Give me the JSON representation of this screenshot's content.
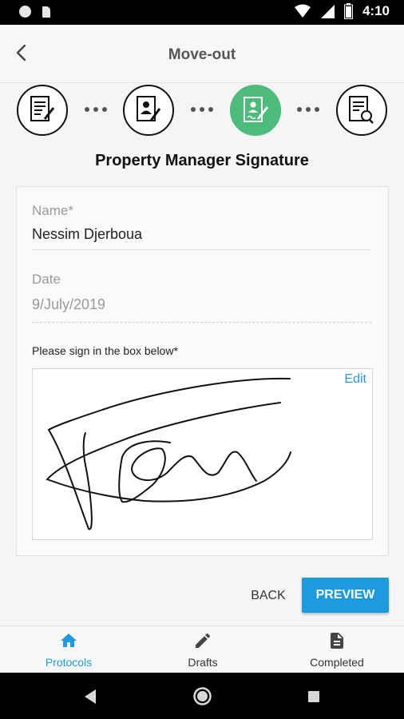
{
  "status_bar": {
    "time": "4:10"
  },
  "app_bar": {
    "title": "Move-out"
  },
  "steps": [
    {
      "icon": "contract-edit-icon",
      "state": "done"
    },
    {
      "icon": "person-document-icon",
      "state": "done"
    },
    {
      "icon": "signature-document-icon",
      "state": "active"
    },
    {
      "icon": "document-review-icon",
      "state": "pending"
    }
  ],
  "section_title": "Property Manager Signature",
  "form": {
    "name_label": "Name*",
    "name_value": "Nessim Djerboua",
    "date_label": "Date",
    "date_value": "9/July/2019",
    "sign_hint": "Please sign in the box below*",
    "edit_label": "Edit"
  },
  "actions": {
    "back_label": "BACK",
    "preview_label": "PREVIEW"
  },
  "bottom_nav": [
    {
      "label": "Protocols",
      "icon": "home-icon",
      "active": true
    },
    {
      "label": "Drafts",
      "icon": "pencil-icon",
      "active": false
    },
    {
      "label": "Completed",
      "icon": "document-icon",
      "active": false
    }
  ],
  "colors": {
    "accent": "#1e9ae0",
    "step_active": "#4dbb7a"
  }
}
